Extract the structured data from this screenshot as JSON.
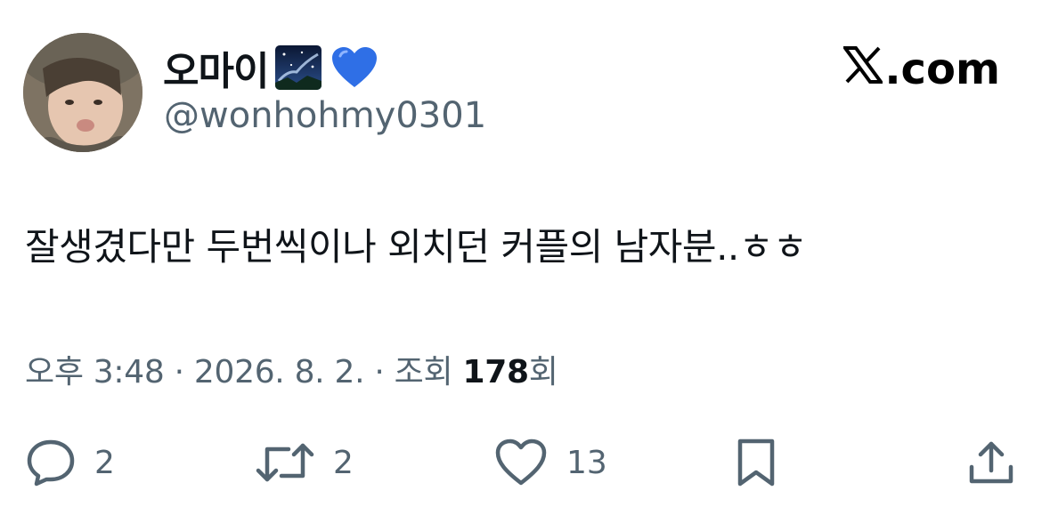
{
  "user": {
    "display_name": "오마이",
    "handle": "@wonhohmy0301",
    "badge_emojis": [
      "night-sky-emoji",
      "blue-heart-emoji"
    ]
  },
  "brand": {
    "label": ".com"
  },
  "tweet": {
    "text": "잘생겼다만 두번씩이나 외치던 커플의 남자분..ㅎㅎ"
  },
  "meta": {
    "time": "오후 3:48",
    "sep1": " · ",
    "date": "2026. 8. 2.",
    "sep2": " · ",
    "views_prefix": "조회 ",
    "views_count": "178",
    "views_suffix": "회"
  },
  "actions": {
    "reply_count": "2",
    "retweet_count": "2",
    "like_count": "13",
    "icons": [
      "reply-icon",
      "retweet-icon",
      "like-icon",
      "bookmark-icon",
      "share-icon"
    ]
  },
  "colors": {
    "text": "#0f1419",
    "secondary": "#536471",
    "heart_blue": "#2f6fe6"
  }
}
